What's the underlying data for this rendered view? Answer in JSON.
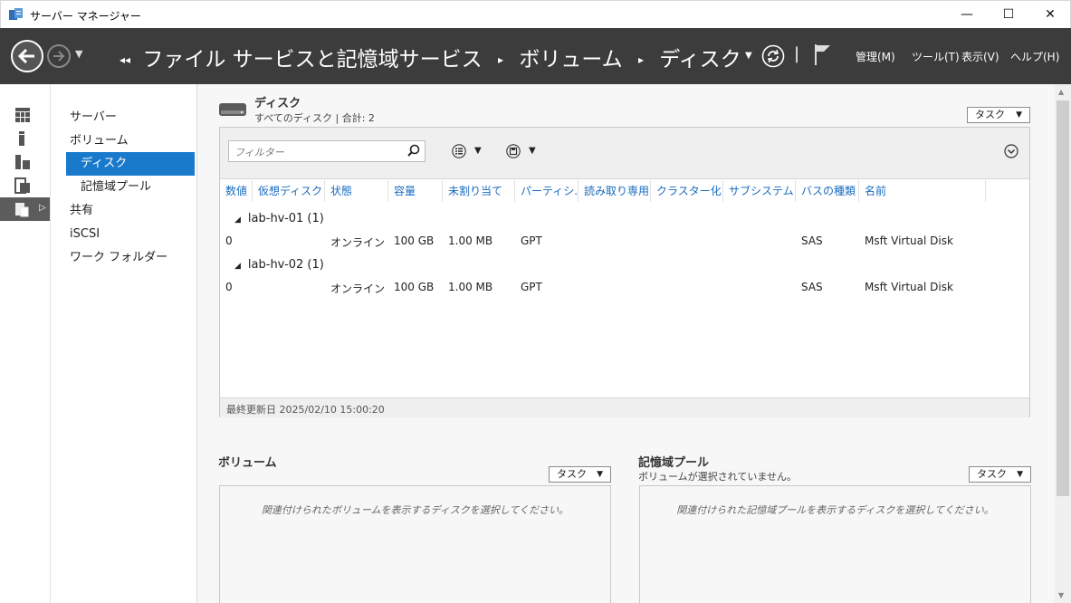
{
  "window": {
    "title": "サーバー マネージャー",
    "min": "—",
    "max": "☐",
    "close": "✕"
  },
  "header": {
    "breadcrumb_lead": "◂◂",
    "crumbs": [
      "ファイル サービスと記憶域サービス",
      "ボリューム",
      "ディスク"
    ],
    "sep": "▸",
    "menus": [
      "管理(M)",
      "ツール(T)",
      "表示(V)",
      "ヘルプ(H)"
    ]
  },
  "rail": {
    "icons": [
      "dashboard-icon",
      "local-server-icon",
      "all-servers-icon",
      "file-services-icon",
      "storage-services-icon"
    ]
  },
  "tree": {
    "items": [
      {
        "label": "サーバー"
      },
      {
        "label": "ボリューム"
      },
      {
        "label": "ディスク"
      },
      {
        "label": "記憶域プール"
      },
      {
        "label": "共有"
      },
      {
        "label": "iSCSI"
      },
      {
        "label": "ワーク フォルダー"
      }
    ]
  },
  "disks": {
    "title": "ディスク",
    "subtitle": "すべてのディスク | 合計: 2",
    "task_label": "タスク",
    "filter_placeholder": "フィルター",
    "columns": [
      "数値",
      "仮想ディスク",
      "状態",
      "容量",
      "未割り当て",
      "パーティシ...",
      "読み取り専用",
      "クラスター化",
      "サブシステム",
      "バスの種類",
      "名前"
    ],
    "groups": [
      {
        "label": "lab-hv-01 (1)",
        "row": {
          "number": "0",
          "virtual_disk": "",
          "status": "オンライン",
          "capacity": "100 GB",
          "unallocated": "1.00 MB",
          "partition": "GPT",
          "bus": "SAS",
          "name": "Msft Virtual Disk"
        }
      },
      {
        "label": "lab-hv-02 (1)",
        "row": {
          "number": "0",
          "virtual_disk": "",
          "status": "オンライン",
          "capacity": "100 GB",
          "unallocated": "1.00 MB",
          "partition": "GPT",
          "bus": "SAS",
          "name": "Msft Virtual Disk"
        }
      }
    ],
    "last_updated": "最終更新日 2025/02/10 15:00:20"
  },
  "volumes": {
    "title": "ボリューム",
    "task_label": "タスク",
    "empty_msg": "関連付けられたボリュームを表示するディスクを選択してください。"
  },
  "pools": {
    "title": "記憶域プール",
    "subtitle": "ボリュームが選択されていません。",
    "task_label": "タスク",
    "empty_msg": "関連付けられた記憶域プールを表示するディスクを選択してください。"
  },
  "colors": {
    "header_bg": "#3c3c3c",
    "selection": "#1979ca",
    "column_text": "#1a6cc0"
  }
}
